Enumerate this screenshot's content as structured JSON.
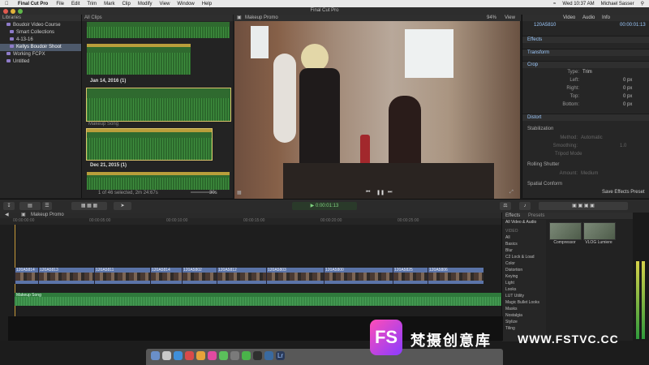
{
  "menubar": {
    "app": "Final Cut Pro",
    "items": [
      "File",
      "Edit",
      "Trim",
      "Mark",
      "Clip",
      "Modify",
      "View",
      "Window",
      "Help"
    ],
    "clock": "Wed 10:37 AM",
    "user": "Michael Sasser"
  },
  "window": {
    "title": "Final Cut Pro"
  },
  "libraries": {
    "header": "Libraries",
    "items": [
      "Boudoir Video Course",
      "Smart Collections",
      "4-13-16",
      "Kellys Boudoir Shoot",
      "Working FCPX",
      "Untitled"
    ]
  },
  "browser": {
    "filter": "All Clips",
    "dates": [
      "Jan 14, 2016  (1)",
      "Dec 21, 2015  (1)"
    ],
    "clip_label": "Makeup Song",
    "status": "1 of 46 selected, 2m 24:67s",
    "zoom": "30s"
  },
  "viewer": {
    "title": "Makeup Promo",
    "zoom": "94%",
    "view": "View"
  },
  "inspector": {
    "tabs": [
      "Video",
      "Audio",
      "Info"
    ],
    "timecode": "00:00:01:13",
    "clip_id": "120A5810",
    "sections": [
      "Effects",
      "Transform",
      "Crop",
      "Distort",
      "Stabilization",
      "Rolling Shutter",
      "Spatial Conform"
    ],
    "crop": {
      "type_label": "Type:",
      "type_value": "Trim",
      "left": "Left:",
      "right": "Right:",
      "top": "Top:",
      "bottom": "Bottom:",
      "unit": "0 px"
    },
    "stab": {
      "method": "Method:",
      "method_value": "Automatic",
      "smoothing": "Smoothing:",
      "smoothing_value": "1.0",
      "tripod": "Tripod Mode"
    },
    "rs": {
      "amount": "Amount:",
      "amount_value": "Medium"
    },
    "save": "Save Effects Preset"
  },
  "timeline": {
    "project": "Makeup Promo",
    "ruler": [
      "00:00:00:00",
      "00:00:05:00",
      "00:00:10:00",
      "00:00:15:00",
      "00:00:20:00",
      "00:00:25:00"
    ],
    "clips": [
      "120A5814",
      "120A5813",
      "120A5811",
      "120A5814",
      "120A5802",
      "120A5812",
      "120A5803",
      "120A5800",
      "120A5825",
      "120A5806"
    ],
    "audio_label": "Makeup Song"
  },
  "effects": {
    "tabs": [
      "Effects",
      "Presets"
    ],
    "header": "All Video & Audio",
    "categories": [
      "VIDEO",
      "All",
      "Basics",
      "Blur",
      "C2 Lock & Load",
      "Color",
      "Distortion",
      "Keying",
      "Light",
      "Looks",
      "LUT Utility",
      "Magic Bullet Looks",
      "Masks",
      "Nostalgia",
      "Stylize",
      "Tiling"
    ],
    "items": [
      "Compressor",
      "VLOG Lumiere"
    ]
  },
  "watermark": {
    "logo": "FS",
    "cn": "梵摄创意库",
    "url": "WWW.FSTVC.CC"
  },
  "colors": {
    "accent": "#5b74a8",
    "selection": "#4e5a6c",
    "audio": "#2f7a3c"
  }
}
